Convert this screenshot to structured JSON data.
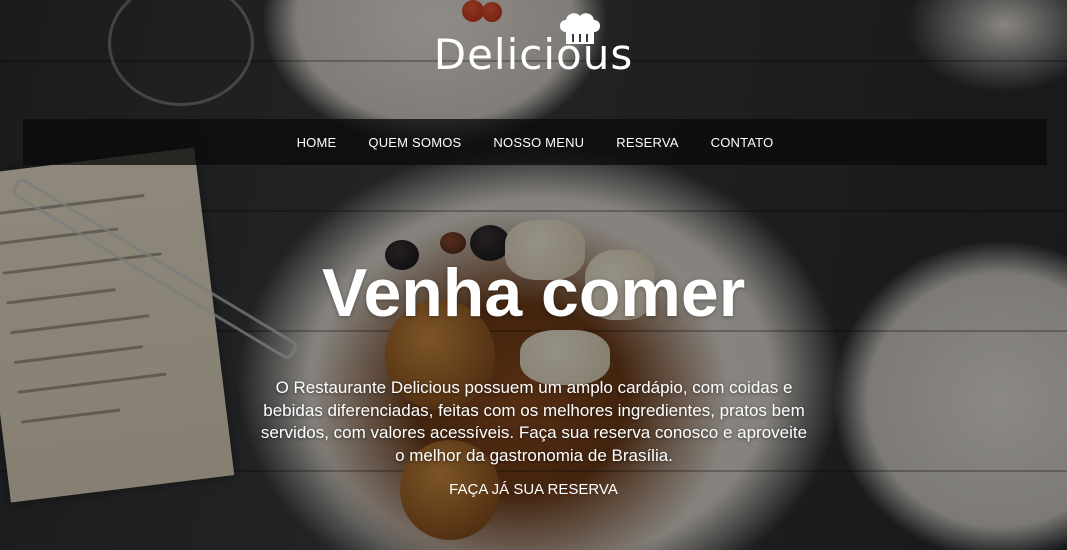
{
  "brand": {
    "name": "Delicious",
    "logo_icon": "chef-hat-icon"
  },
  "nav": {
    "items": [
      {
        "label": "HOME"
      },
      {
        "label": "QUEM SOMOS"
      },
      {
        "label": "NOSSO MENU"
      },
      {
        "label": "RESERVA"
      },
      {
        "label": "CONTATO"
      }
    ]
  },
  "hero": {
    "headline": "Venha comer",
    "description": "O Restaurante Delicious possuem um amplo cardápio, com coidas e bebidas diferenciadas, feitas com os melhores ingredientes, pratos bem servidos, com valores acessíveis. Faça sua reserva conosco e aproveite o melhor da gastronomia de Brasília.",
    "cta_label": "FAÇA JÁ SUA RESERVA"
  },
  "colors": {
    "text": "#ffffff",
    "navbar_bg": "#0a0a0a"
  }
}
